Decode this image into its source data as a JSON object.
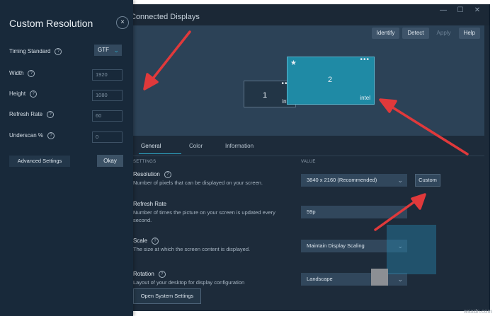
{
  "window": {
    "title": "Connected Displays",
    "controls": [
      "—",
      "☐",
      "✕"
    ]
  },
  "toolbar": {
    "identify": "Identify",
    "detect": "Detect",
    "apply": "Apply",
    "help": "Help"
  },
  "monitors": [
    {
      "number": "1",
      "brand": "intel",
      "dots": "•••"
    },
    {
      "number": "2",
      "brand": "intel",
      "dots": "•••",
      "star": "★",
      "selected": true
    }
  ],
  "tabs": [
    {
      "label": "General",
      "active": true
    },
    {
      "label": "Color",
      "active": false
    },
    {
      "label": "Information",
      "active": false
    }
  ],
  "columns": {
    "settings": "SETTINGS",
    "value": "VALUE"
  },
  "settings": {
    "resolution": {
      "title": "Resolution",
      "desc": "Number of pixels that can be displayed on your screen.",
      "value": "3840 x 2160 (Recommended)",
      "custom_label": "Custom"
    },
    "refresh": {
      "title": "Refresh Rate",
      "desc": "Number of times the picture on your screen is updated every second.",
      "value": "59p"
    },
    "scale": {
      "title": "Scale",
      "desc": "The size at which the screen content is displayed.",
      "value": "Maintain Display Scaling"
    },
    "rotation": {
      "title": "Rotation",
      "desc": "Layout of your desktop for display configuration",
      "value": "Landscape"
    },
    "open_system_settings": "Open System Settings"
  },
  "custom_resolution": {
    "title": "Custom Resolution",
    "close": "×",
    "timing_label": "Timing Standard",
    "timing_value": "GTF",
    "width_label": "Width",
    "width_placeholder": "1920",
    "height_label": "Height",
    "height_placeholder": "1080",
    "refresh_label": "Refresh Rate",
    "refresh_placeholder": "60",
    "underscan_label": "Underscan %",
    "underscan_placeholder": "0",
    "advanced": "Advanced Settings",
    "okay": "Okay"
  },
  "icons": {
    "info": "?",
    "chevron": "⌄"
  },
  "colors": {
    "accent": "#2ea7c7",
    "arrow": "#e0393b",
    "panel_bg": "#18293a",
    "window_bg": "#1d2b3a"
  },
  "watermark": "wsxdn.com"
}
